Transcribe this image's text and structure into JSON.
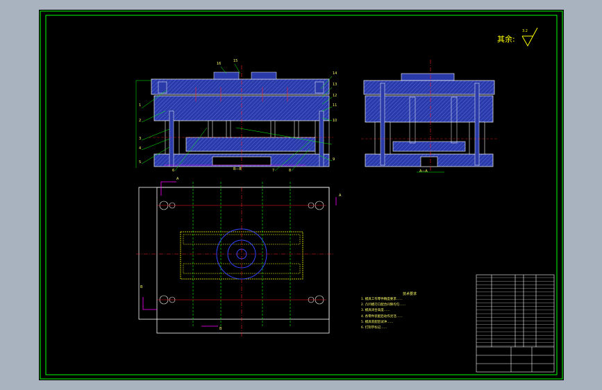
{
  "drawing": {
    "roughness_label": "其余:",
    "roughness_value": "3.2"
  },
  "view_labels": {
    "section_front": "B—B",
    "section_side": "A—A",
    "plan_a_left": "A",
    "plan_a_right": "A",
    "plan_b_top": "B",
    "plan_b_bottom": "B"
  },
  "part_numbers": {
    "left_side": [
      "1",
      "2",
      "3",
      "4",
      "5"
    ],
    "top": [
      "16",
      "15"
    ],
    "right_side": [
      "14",
      "13",
      "12",
      "11",
      "10",
      "9"
    ],
    "bottom": [
      "6",
      "7",
      "8"
    ]
  },
  "technical_requirements": {
    "title": "技术要求",
    "lines": [
      "1. 模具工作零件精度要求……",
      "2. 凸凹模刃口配合间隙均匀……",
      "3. 模具闭合高度……",
      "4. 各零件装配后动作灵活……",
      "5. 模具装配后试冲……",
      "6. 打刻字标记……"
    ]
  },
  "title_block": {
    "drawing_number": "",
    "scale": "",
    "name": ""
  },
  "colors": {
    "background": "#000000",
    "border": "#00ff00",
    "steel": "#2a3aa8",
    "hatch": "#5a6fe0",
    "centerline": "#ff2020",
    "dimension": "#ff00ff",
    "annotation": "#ffff00",
    "outline": "#ffffff"
  }
}
